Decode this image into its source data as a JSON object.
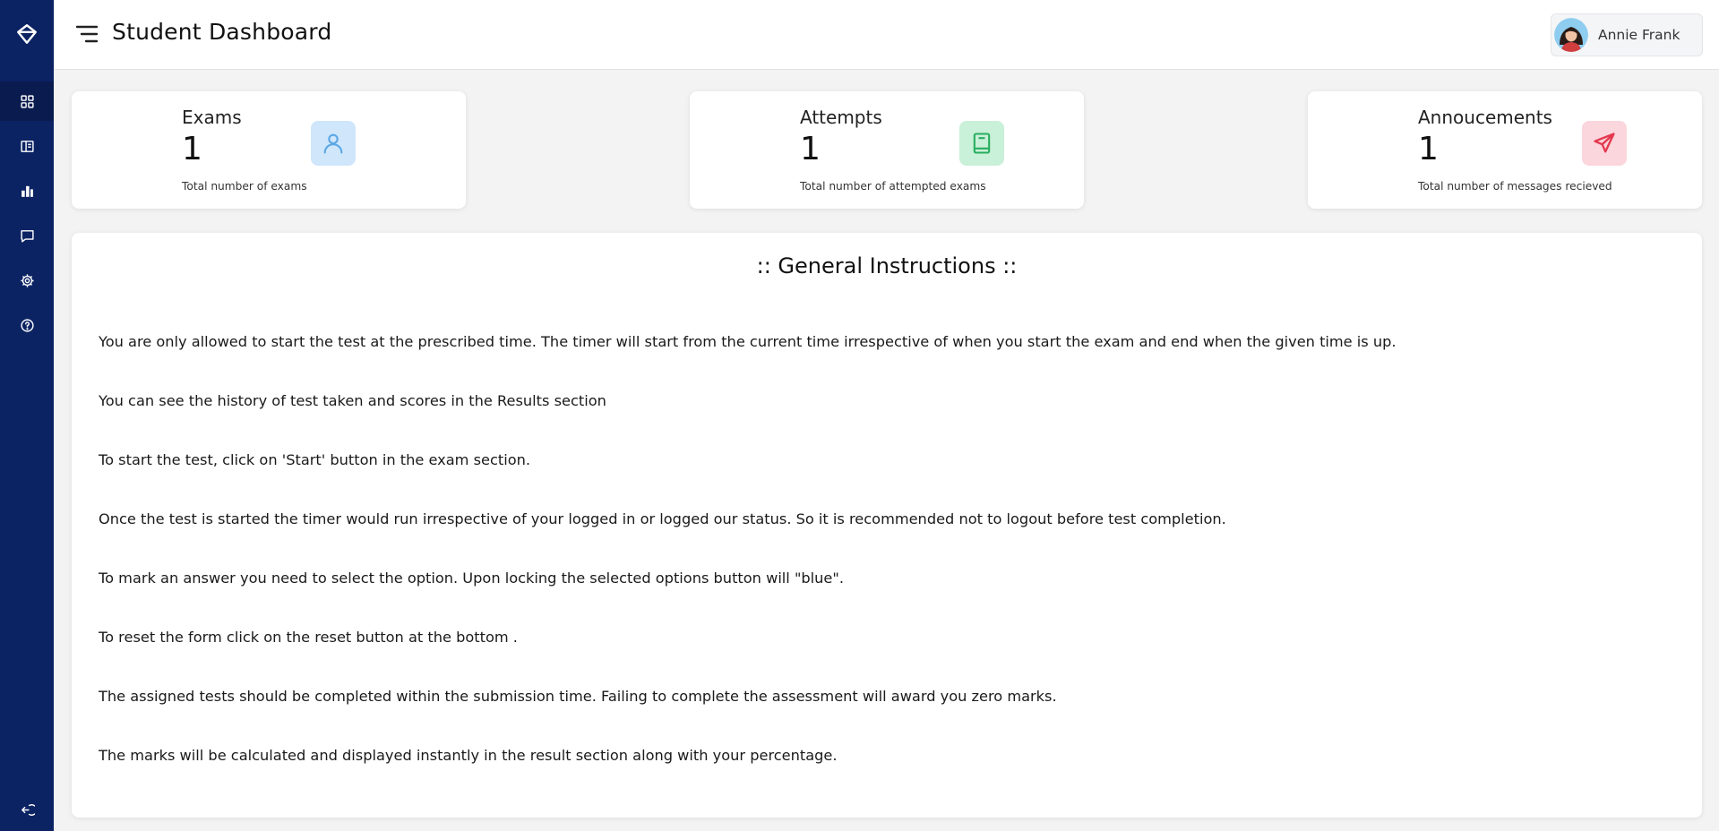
{
  "app": {
    "title": "Student Dashboard"
  },
  "colors": {
    "sidebar": "#0b2363",
    "exams_icon_bg": "#cfe6fb",
    "exams_icon": "#5aa7e6",
    "attempts_icon_bg": "#c9f0d8",
    "attempts_icon": "#27ae60",
    "announcements_icon_bg": "#fbd6dc",
    "announcements_icon": "#e4384f"
  },
  "sidebar": {
    "logo_icon": "diamond-icon",
    "items": [
      {
        "icon": "dashboard-icon",
        "active": true
      },
      {
        "icon": "exam-panel-icon"
      },
      {
        "icon": "results-chart-icon"
      },
      {
        "icon": "messages-icon"
      },
      {
        "icon": "settings-gear-icon"
      },
      {
        "icon": "help-icon"
      }
    ],
    "logout_icon": "logout-icon"
  },
  "header": {
    "menu_icon": "hamburger-menu-icon",
    "user": {
      "name": "Annie Frank",
      "avatar_icon": "user-avatar"
    }
  },
  "stats": [
    {
      "title": "Exams",
      "value": "1",
      "description": "Total number of exams",
      "icon": "user-icon"
    },
    {
      "title": "Attempts",
      "value": "1",
      "description": "Total number of attempted exams",
      "icon": "book-icon"
    },
    {
      "title": "Annoucements",
      "value": "1",
      "description": "Total number of messages recieved",
      "icon": "send-icon"
    }
  ],
  "instructions": {
    "title": ":: General Instructions ::",
    "items": [
      "You are only allowed to start the test at the prescribed time. The timer will start from the current time irrespective of when you start the exam and end when the given time is up.",
      "You can see the history of test taken and scores in the Results section",
      "To start the test, click on 'Start' button in the exam section.",
      "Once the test is started the timer would run irrespective of your logged in or logged our status. So it is recommended not to logout before test completion.",
      "To mark an answer you need to select the option. Upon locking the selected options button will \"blue\".",
      "To reset the form click on the reset button at the bottom .",
      "The assigned tests should be completed within the submission time. Failing to complete the assessment will award you zero marks.",
      "The marks will be calculated and displayed instantly in the result section along with your percentage."
    ]
  }
}
